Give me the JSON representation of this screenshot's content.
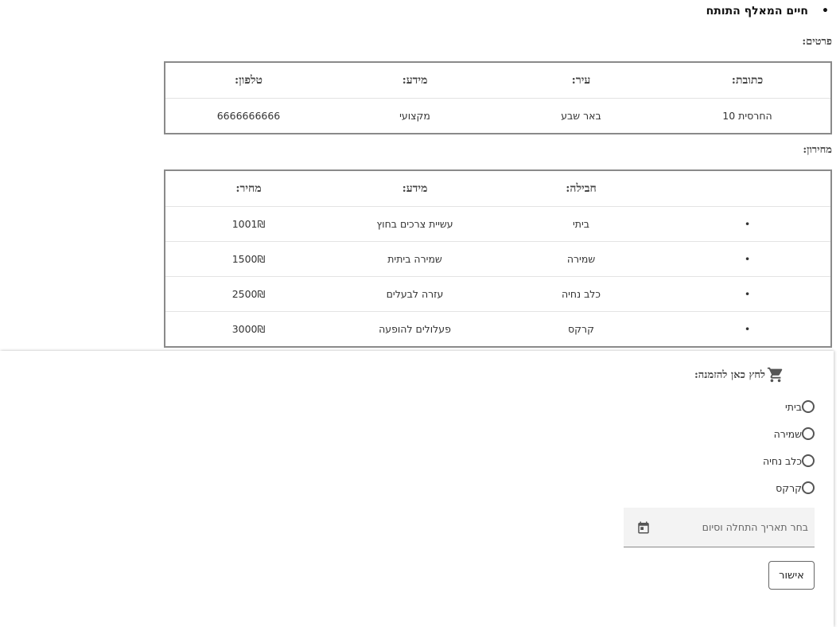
{
  "profile": {
    "name": "חיים המאלף התותח",
    "details_label": "פרטים:",
    "details_headers": [
      "כתובת:",
      "עיר:",
      "מידע:",
      "טלפון:"
    ],
    "details_values": [
      "החרסית 10",
      "באר שבע",
      "מקצועי",
      "6666666666"
    ]
  },
  "pricing": {
    "label": "מחירון:",
    "headers": [
      "",
      "חבילה:",
      "מידע:",
      "מחיר:"
    ],
    "rows": [
      {
        "bullet": "•",
        "package": "ביתי",
        "info": "עשיית צרכים בחוץ",
        "price": "1001₪"
      },
      {
        "bullet": "•",
        "package": "שמירה",
        "info": "שמירה ביתית",
        "price": "1500₪"
      },
      {
        "bullet": "•",
        "package": "כלב נחיה",
        "info": "עזרה לבעלים",
        "price": "2500₪"
      },
      {
        "bullet": "•",
        "package": "קרקס",
        "info": "פעלולים להופעה",
        "price": "3000₪"
      }
    ]
  },
  "order": {
    "label": "לחץ כאן להזמנה:",
    "cart_icon": "shopping-cart-icon",
    "options": [
      "ביתי",
      "שמירה",
      "כלב נחיה",
      "קרקס"
    ],
    "date_placeholder": "בחר תאריך התחלה וסיום",
    "calendar_icon": "calendar-icon",
    "confirm_label": "אישור"
  }
}
